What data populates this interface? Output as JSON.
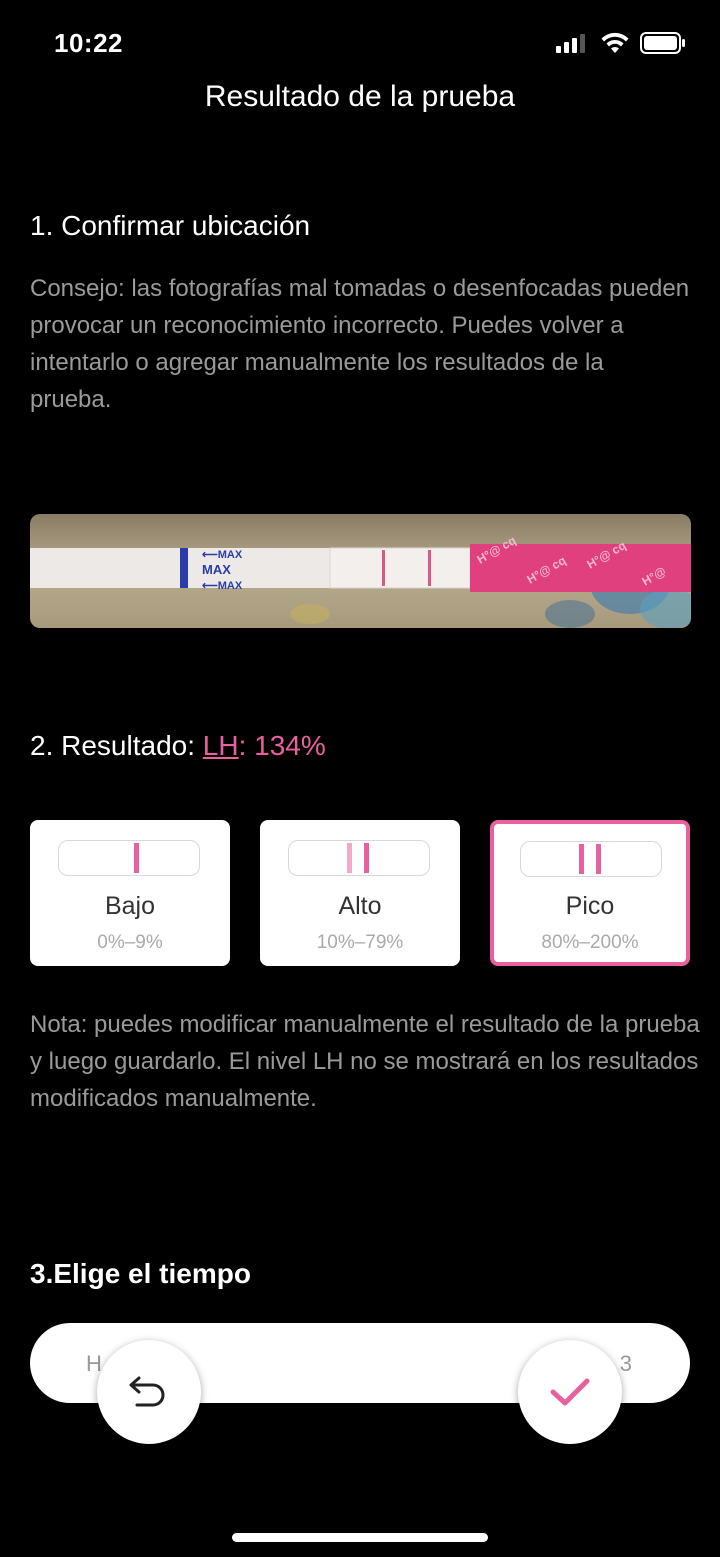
{
  "status_bar": {
    "time": "10:22"
  },
  "header": {
    "title": "Resultado de la prueba"
  },
  "section1": {
    "title": "1. Confirmar ubicación",
    "tip": "Consejo: las fotografías mal tomadas o desenfocadas pueden provocar un reconocimiento incorrecto. Puedes volver a intentarlo o agregar manualmente los resultados de la prueba."
  },
  "photo": {
    "marking": "MAX"
  },
  "section2": {
    "prefix": "2. Resultado: ",
    "lh_link": "LH",
    "value": ": 134%",
    "options": [
      {
        "label": "Bajo",
        "range": "0%–9%",
        "selected": false
      },
      {
        "label": "Alto",
        "range": "10%–79%",
        "selected": false
      },
      {
        "label": "Pico",
        "range": "80%–200%",
        "selected": true
      }
    ],
    "note": "Nota: puedes modificar manualmente el resultado de la prueba y luego guardarlo. El nivel LH no se mostrará en los resultados modificados manualmente."
  },
  "section3": {
    "title": "3.Elige el tiempo",
    "time_left_fragment": "H",
    "time_right_fragment": "3"
  },
  "icons": {
    "undo": "undo-icon",
    "confirm": "check-icon"
  },
  "colors": {
    "accent": "#e9609e",
    "background": "#000000"
  }
}
